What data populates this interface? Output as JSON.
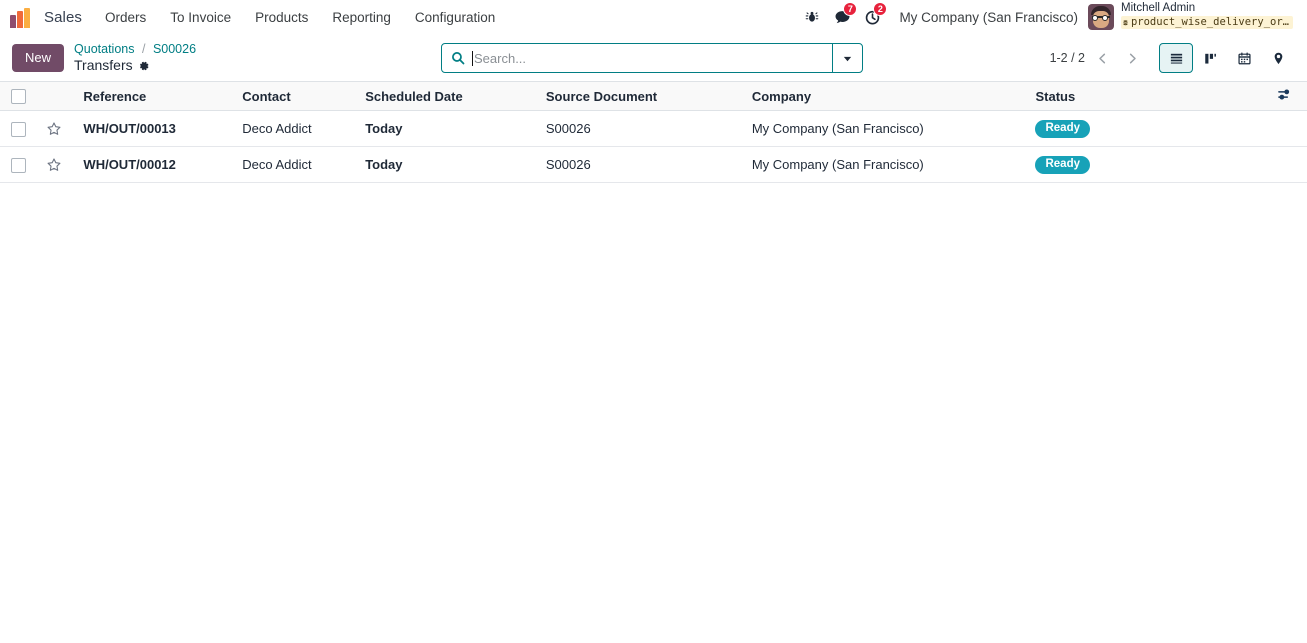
{
  "navbar": {
    "brand_icon": "odoo-bars-logo",
    "app_title": "Sales",
    "menu_items": [
      {
        "label": "Orders"
      },
      {
        "label": "To Invoice"
      },
      {
        "label": "Products"
      },
      {
        "label": "Reporting"
      },
      {
        "label": "Configuration"
      }
    ],
    "systray": {
      "bug_icon": "bug-icon",
      "messages_icon": "chat-bubble-icon",
      "messages_count": "7",
      "activities_icon": "clock-icon",
      "activities_count": "2",
      "company": "My Company (San Francisco)",
      "user_name": "Mitchell Admin",
      "database_icon": "database-icon",
      "database_name": "product_wise_delivery_or…",
      "avatar_alt": "avatar"
    }
  },
  "control_panel": {
    "new_label": "New",
    "breadcrumb": {
      "parent": "Quotations",
      "separator": "/",
      "record": "S00026",
      "current": "Transfers",
      "settings_icon": "gear-icon"
    },
    "search": {
      "icon": "search-icon",
      "placeholder": "Search...",
      "value": "",
      "dropdown_icon": "chevron-down-icon"
    },
    "pager": {
      "range": "1-2 / 2",
      "previous_icon": "chevron-left-icon",
      "next_icon": "chevron-right-icon"
    },
    "views": [
      {
        "name": "list",
        "icon": "list-view-icon",
        "active": true
      },
      {
        "name": "kanban",
        "icon": "kanban-view-icon",
        "active": false
      },
      {
        "name": "calendar",
        "icon": "calendar-view-icon",
        "active": false
      },
      {
        "name": "map",
        "icon": "map-pin-view-icon",
        "active": false
      }
    ]
  },
  "list_view": {
    "select_all_checkbox": "",
    "optional_columns_icon": "sliders-icon",
    "columns": [
      {
        "key": "reference",
        "label": "Reference"
      },
      {
        "key": "contact",
        "label": "Contact"
      },
      {
        "key": "scheduled_date",
        "label": "Scheduled Date"
      },
      {
        "key": "source_document",
        "label": "Source Document"
      },
      {
        "key": "company",
        "label": "Company"
      },
      {
        "key": "status",
        "label": "Status"
      }
    ],
    "rows": [
      {
        "reference": "WH/OUT/00013",
        "contact": "Deco Addict",
        "scheduled_date": "Today",
        "source_document": "S00026",
        "company": "My Company (San Francisco)",
        "status": "Ready"
      },
      {
        "reference": "WH/OUT/00012",
        "contact": "Deco Addict",
        "scheduled_date": "Today",
        "source_document": "S00026",
        "company": "My Company (San Francisco)",
        "status": "Ready"
      }
    ]
  },
  "colors": {
    "brand_purple": "#714b67",
    "accent_teal": "#017e84",
    "status_ready": "#17a2b8",
    "date_warning": "#b5801b",
    "badge_red": "#e7223c"
  }
}
